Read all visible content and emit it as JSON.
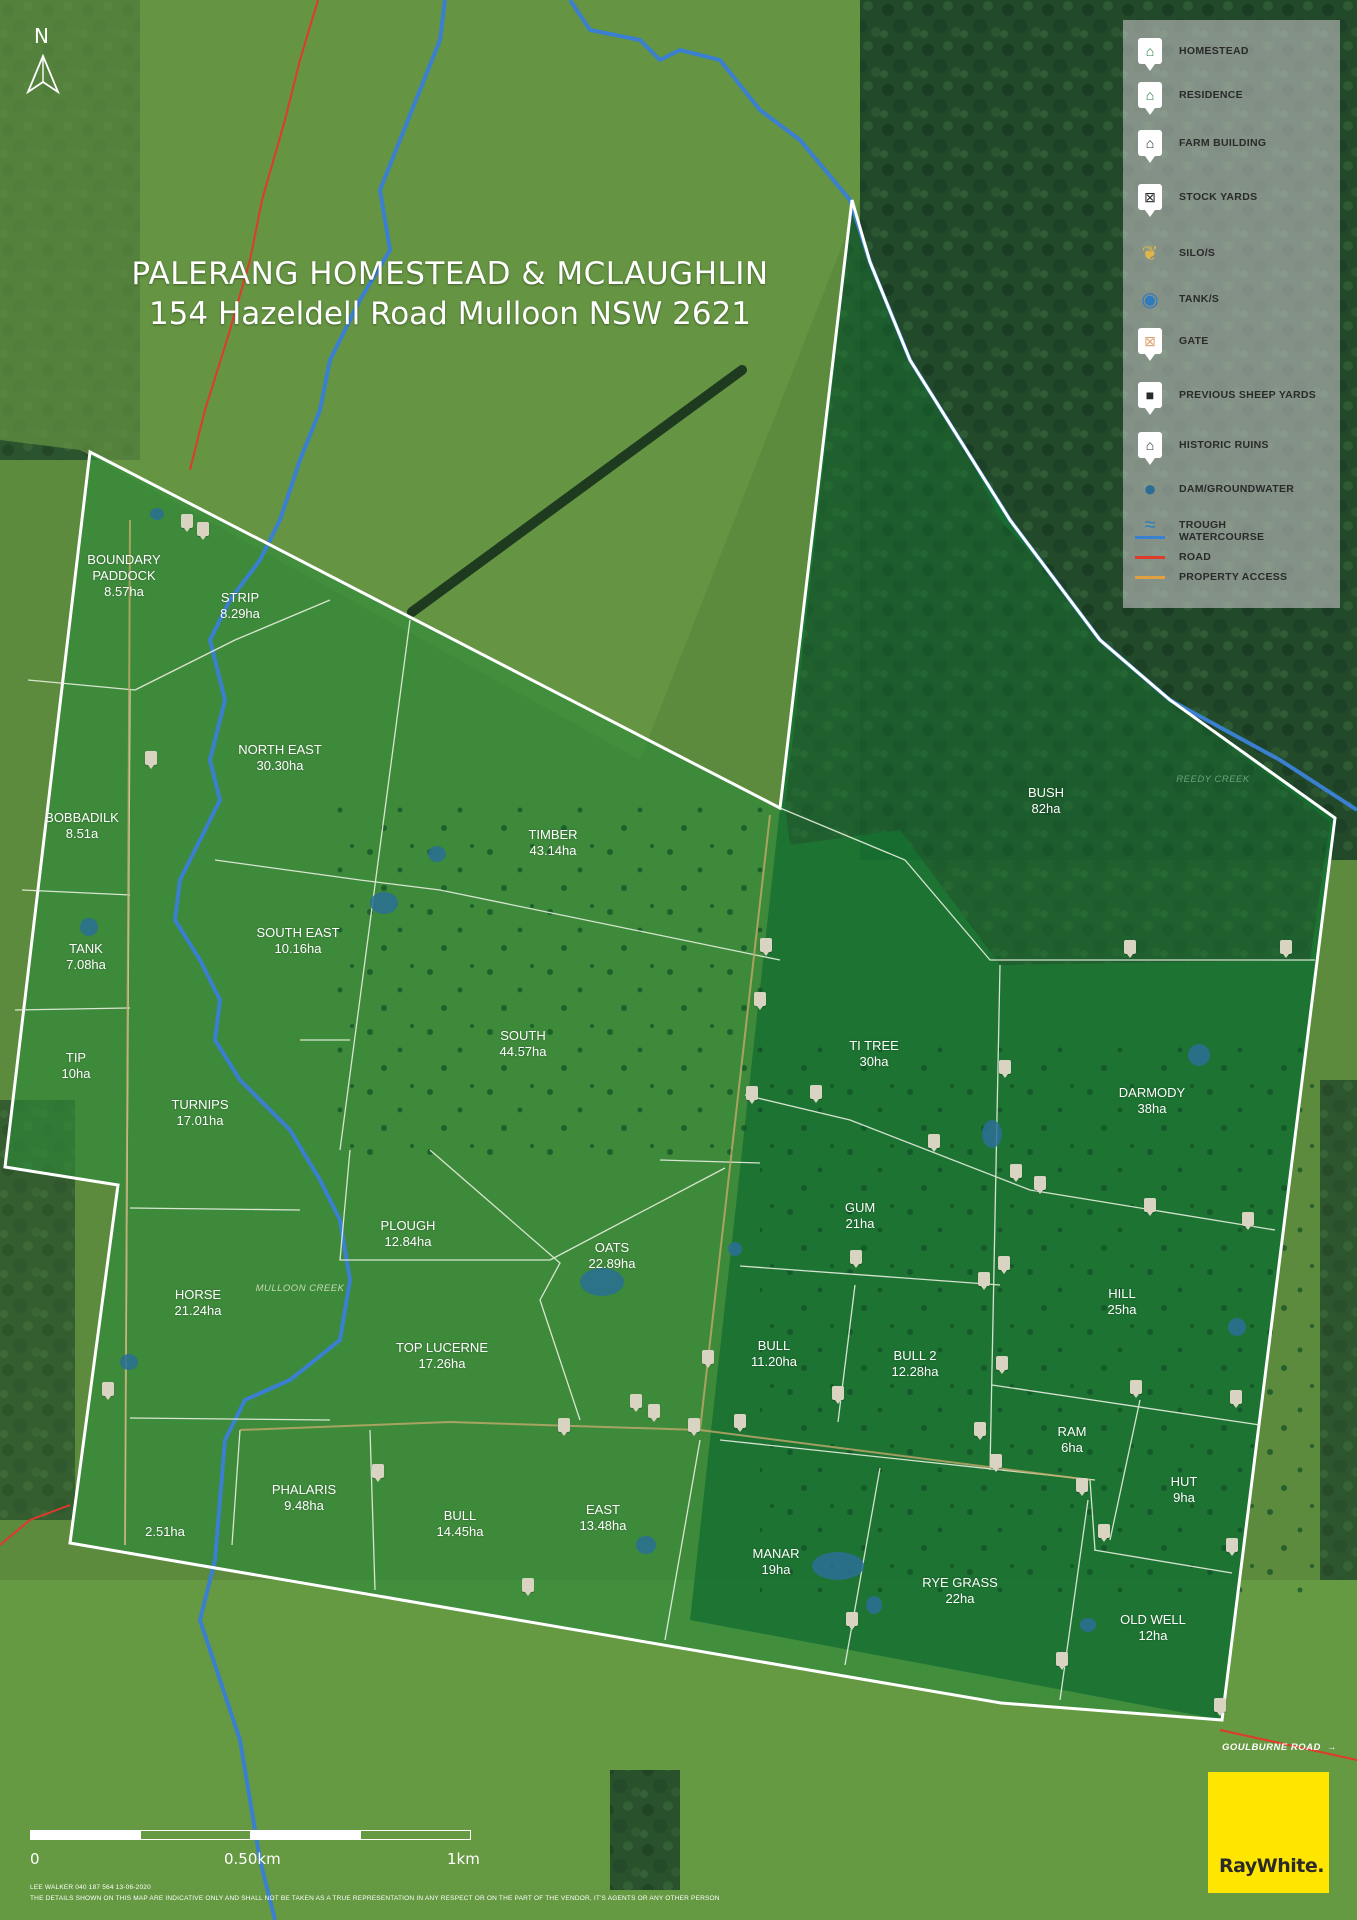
{
  "title": {
    "line1": "PALERANG HOMESTEAD & MCLAUGHLIN",
    "line2": "154 Hazeldell Road Mulloon NSW 2621"
  },
  "north_label": "N",
  "legend": [
    {
      "label": "HOMESTEAD",
      "icon": "house-icon",
      "color": "#1f7a3c"
    },
    {
      "label": "RESIDENCE",
      "icon": "house-outline-icon",
      "color": "#1f7a3c"
    },
    {
      "label": "FARM BUILDING",
      "icon": "barn-icon",
      "color": "#2a2a2a"
    },
    {
      "label": "STOCK YARDS",
      "icon": "yard-icon",
      "color": "#2a2a2a"
    },
    {
      "label": "SILO/S",
      "icon": "wheat-icon",
      "color": "#e0b54a"
    },
    {
      "label": "TANK/S",
      "icon": "water-drop-icon",
      "color": "#2f7bbf"
    },
    {
      "label": "GATE",
      "icon": "gate-icon",
      "color": "#e0a070"
    },
    {
      "label": "PREVIOUS SHEEP YARDS",
      "icon": "sheep-icon",
      "color": "#2a2a2a"
    },
    {
      "label": "HISTORIC RUINS",
      "icon": "ruins-icon",
      "color": "#2a2a2a"
    },
    {
      "label": "DAM/GROUNDWATER",
      "icon": "dam-icon",
      "color": "#2a6e96"
    },
    {
      "label": "TROUGH",
      "icon": "trough-icon",
      "color": "#2f7bbf"
    },
    {
      "label": "WATERCOURSE",
      "icon": "watercourse-line",
      "color": "#3a7fd0"
    },
    {
      "label": "ROAD",
      "icon": "road-line",
      "color": "#e03a2a"
    },
    {
      "label": "PROPERTY ACCESS",
      "icon": "access-line",
      "color": "#e0a040"
    }
  ],
  "paddocks": [
    {
      "name": "BOUNDARY\nPADDOCK",
      "area": "8.57ha"
    },
    {
      "name": "STRIP",
      "area": "8.29ha"
    },
    {
      "name": "NORTH EAST",
      "area": "30.30ha"
    },
    {
      "name": "BOBBADILK",
      "area": "8.51a"
    },
    {
      "name": "TIMBER",
      "area": "43.14ha"
    },
    {
      "name": "SOUTH EAST",
      "area": "10.16ha"
    },
    {
      "name": "TANK",
      "area": "7.08ha"
    },
    {
      "name": "SOUTH",
      "area": "44.57ha"
    },
    {
      "name": "TIP",
      "area": "10ha"
    },
    {
      "name": "TURNIPS",
      "area": "17.01ha"
    },
    {
      "name": "PLOUGH",
      "area": "12.84ha"
    },
    {
      "name": "OATS",
      "area": "22.89ha"
    },
    {
      "name": "HORSE",
      "area": "21.24ha"
    },
    {
      "name": "TOP LUCERNE",
      "area": "17.26ha"
    },
    {
      "name": "",
      "area": "2.51ha"
    },
    {
      "name": "PHALARIS",
      "area": "9.48ha"
    },
    {
      "name": "BULL",
      "area": "14.45ha"
    },
    {
      "name": "EAST",
      "area": "13.48ha"
    },
    {
      "name": "BUSH",
      "area": "82ha"
    },
    {
      "name": "TI TREE",
      "area": "30ha"
    },
    {
      "name": "DARMODY",
      "area": "38ha"
    },
    {
      "name": "GUM",
      "area": "21ha"
    },
    {
      "name": "HILL",
      "area": "25ha"
    },
    {
      "name": "BULL",
      "area": "11.20ha"
    },
    {
      "name": "BULL 2",
      "area": "12.28ha"
    },
    {
      "name": "RAM",
      "area": "6ha"
    },
    {
      "name": "HUT",
      "area": "9ha"
    },
    {
      "name": "MANAR",
      "area": "19ha"
    },
    {
      "name": "RYE GRASS",
      "area": "22ha"
    },
    {
      "name": "OLD WELL",
      "area": "12ha"
    }
  ],
  "creeks": [
    "MULLOON CREEK",
    "REEDY CREEK"
  ],
  "road_label": "GOULBURNE ROAD",
  "road_arrow": "→",
  "scale": {
    "labels": [
      "0",
      "0.50km",
      "1km"
    ]
  },
  "footer": {
    "line1": "LEE WALKER 040 187 564   13-06-2020",
    "line2": "THE DETAILS SHOWN ON THIS MAP ARE INDICATIVE ONLY AND SHALL NOT BE TAKEN AS A TRUE REPRESENTATION IN ANY RESPECT OR ON THE PART OF THE VENDOR, IT'S AGENTS OR ANY OTHER PERSON"
  },
  "brand": "RayWhite."
}
